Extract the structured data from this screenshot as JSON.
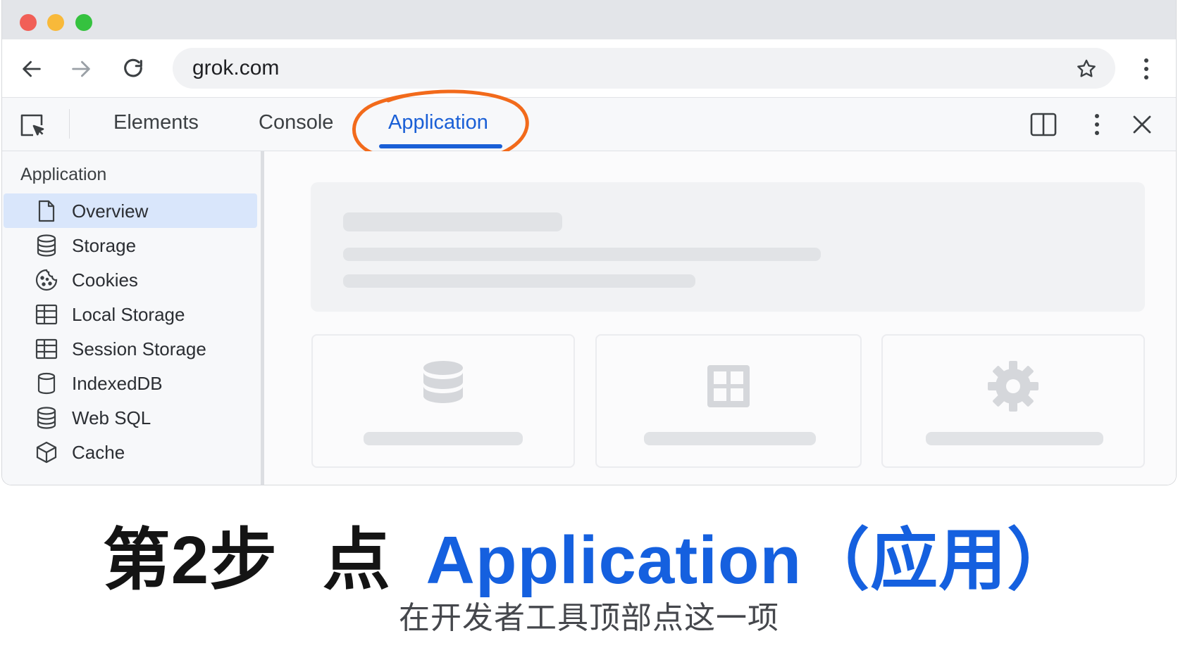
{
  "browser": {
    "address_bar": {
      "url": "grok.com"
    }
  },
  "devtools": {
    "tabs": [
      {
        "label": "Elements",
        "selected": false
      },
      {
        "label": "Console",
        "selected": false
      },
      {
        "label": "Application",
        "selected": true
      }
    ],
    "sidebar": {
      "heading": "Application",
      "items": [
        {
          "label": "Overview",
          "icon": "document-icon",
          "selected": true
        },
        {
          "label": "Storage",
          "icon": "database-icon",
          "selected": false
        },
        {
          "label": "Cookies",
          "icon": "cookie-icon",
          "selected": false
        },
        {
          "label": "Local Storage",
          "icon": "table-icon",
          "selected": false
        },
        {
          "label": "Session Storage",
          "icon": "table-icon",
          "selected": false
        },
        {
          "label": "IndexedDB",
          "icon": "cylinder-icon",
          "selected": false
        },
        {
          "label": "Web SQL",
          "icon": "database-icon",
          "selected": false
        },
        {
          "label": "Cache",
          "icon": "cube-icon",
          "selected": false
        }
      ]
    },
    "main": {
      "cards": [
        {
          "icon": "database-icon"
        },
        {
          "icon": "grid-icon"
        },
        {
          "icon": "gear-icon"
        }
      ]
    },
    "colors": {
      "accent": "#1a5fd6",
      "highlight_ring": "#f26a1b",
      "selected_item_bg": "#d9e6fb"
    }
  },
  "caption": {
    "step": "第2步",
    "action": "点",
    "target": "Application（应用）",
    "subtitle": "在开发者工具顶部点这一项"
  }
}
